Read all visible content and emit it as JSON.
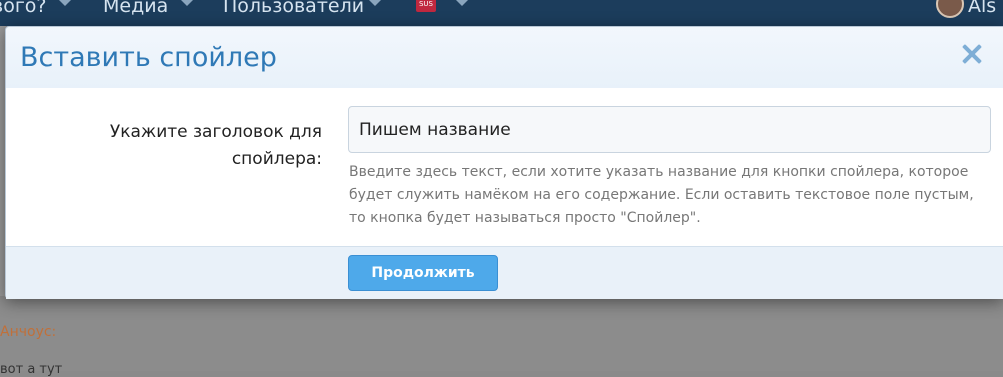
{
  "topnav": {
    "items": [
      {
        "label": "вого?"
      },
      {
        "label": "Медиа"
      },
      {
        "label": "Пользователи"
      }
    ],
    "badge_text": "SUS",
    "username": "Als"
  },
  "background": {
    "quote_author": "Анчоус:",
    "quote_text": "вот а тут"
  },
  "modal": {
    "title": "Вставить спойлер",
    "field_label": "Укажите заголовок для спойлера:",
    "input_value": "Пишем название",
    "hint": "Введите здесь текст, если хотите указать название для кнопки спойлера, которое будет служить намёком на его содержание. Если оставить текстовое поле пустым, то кнопка будет называться просто \"Спойлер\".",
    "continue_label": "Продолжить"
  },
  "colors": {
    "accent": "#2f79b6",
    "button": "#4ea9ea",
    "nav_background": "#1c3d5c"
  }
}
